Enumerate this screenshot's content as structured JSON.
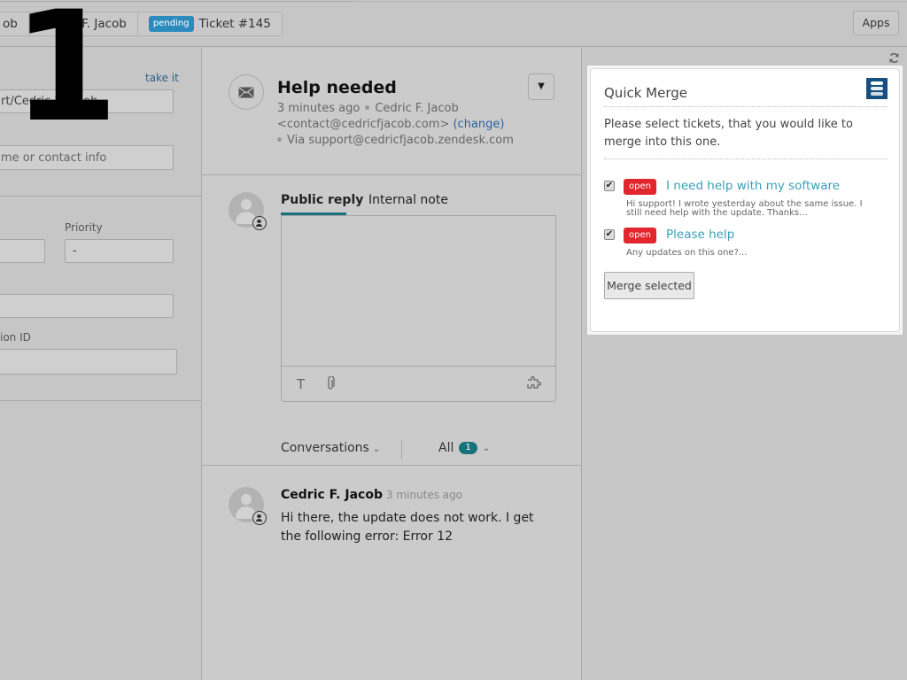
{
  "topbar": {
    "tabs": [
      {
        "label": "ob"
      },
      {
        "label": "Cedric F. Jacob"
      },
      {
        "badge": "pending",
        "label": "Ticket #145"
      }
    ],
    "apps_label": "Apps"
  },
  "overlay": {
    "step_number": "1"
  },
  "sidebar": {
    "take_it": "take it",
    "requester_value": "rt/Cedric F. Jacob",
    "cc_placeholder": "me or contact info",
    "priority_label": "Priority",
    "priority_value": "-",
    "field_type_value": "",
    "field_3_value": "",
    "field_4_label": "ion ID",
    "field_4_value": ""
  },
  "ticket": {
    "subject": "Help needed",
    "time": "3 minutes ago",
    "requester_name": "Cedric F. Jacob",
    "requester_email": "<contact@cedricfjacob.com>",
    "change_label": "(change)",
    "via": "Via support@cedricfjacob.zendesk.com",
    "dropdown_icon": "chevron-down"
  },
  "composer": {
    "tabs": [
      {
        "label": "Public reply",
        "active": true
      },
      {
        "label": "Internal note",
        "active": false
      }
    ],
    "text": "",
    "icons": [
      "text-format-icon",
      "attachment-icon",
      "apps-puzzle-icon"
    ]
  },
  "filters": {
    "conversations_label": "Conversations",
    "all_label": "All",
    "all_count": "1"
  },
  "messages": [
    {
      "author": "Cedric F. Jacob",
      "time": "3 minutes ago",
      "body": "Hi there, the update does not work. I get the following error: Error 12"
    }
  ],
  "quick_merge": {
    "title": "Quick Merge",
    "description": "Please select tickets, that you would like to merge into this one.",
    "tickets": [
      {
        "checked": true,
        "status": "open",
        "title": "I need help with my software",
        "snippet": "Hi support! I wrote yesterday about the same issue. I still need help with the update. Thanks..."
      },
      {
        "checked": true,
        "status": "open",
        "title": "Please help",
        "snippet": "Any updates on this one?..."
      }
    ],
    "merge_button": "Merge selected"
  },
  "colors": {
    "pending_badge": "#2c8bbd",
    "open_badge": "#e3262d",
    "accent_teal": "#17727d",
    "link_blue": "#2a64a0",
    "merge_link": "#3a9fb8",
    "logo_blue": "#17507f"
  }
}
